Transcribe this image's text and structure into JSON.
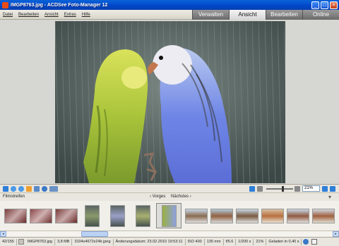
{
  "window": {
    "title": "IMGP8763.jpg - ACDSee Foto-Manager 12",
    "buttons": {
      "minimize": "_",
      "maximize": "□",
      "close": "×"
    }
  },
  "menu": {
    "items": [
      "Datei",
      "Bearbeiten",
      "Ansicht",
      "Extras",
      "Hilfe"
    ]
  },
  "mode_tabs": [
    {
      "label": "Verwalten",
      "active": false
    },
    {
      "label": "Ansicht",
      "active": true
    },
    {
      "label": "Bearbeiten",
      "active": false
    },
    {
      "label": "Online",
      "active": false
    }
  ],
  "toolbar": {
    "zoom_value": "21%",
    "icons": [
      "back-icon",
      "rotate-left-icon",
      "rotate-right-icon",
      "hand-icon",
      "screen-icon",
      "zoom-icon",
      "tools-icon"
    ]
  },
  "filmstrip": {
    "label": "Filmstreifen",
    "prev_label": "‹ Vorges",
    "next_label": "Nächstes ›"
  },
  "status": {
    "index": "42/155",
    "filename": "IMGP8763.jpg",
    "filesize": "3,8 MB",
    "dimensions": "3104x4672x24b jpeg",
    "modified": "Änderungsdatum: 23.02.2010 19:53:11",
    "iso": "ISO 400",
    "focal": "135 mm",
    "aperture": "f/5.6",
    "shutter": "1/200 s",
    "zoom": "21%",
    "loaded": "Geladen in 0,40 s"
  },
  "colors": {
    "titlebar": "#0a5ad6",
    "active_tab": "#e8e8e8",
    "inactive_tab": "#808080"
  }
}
